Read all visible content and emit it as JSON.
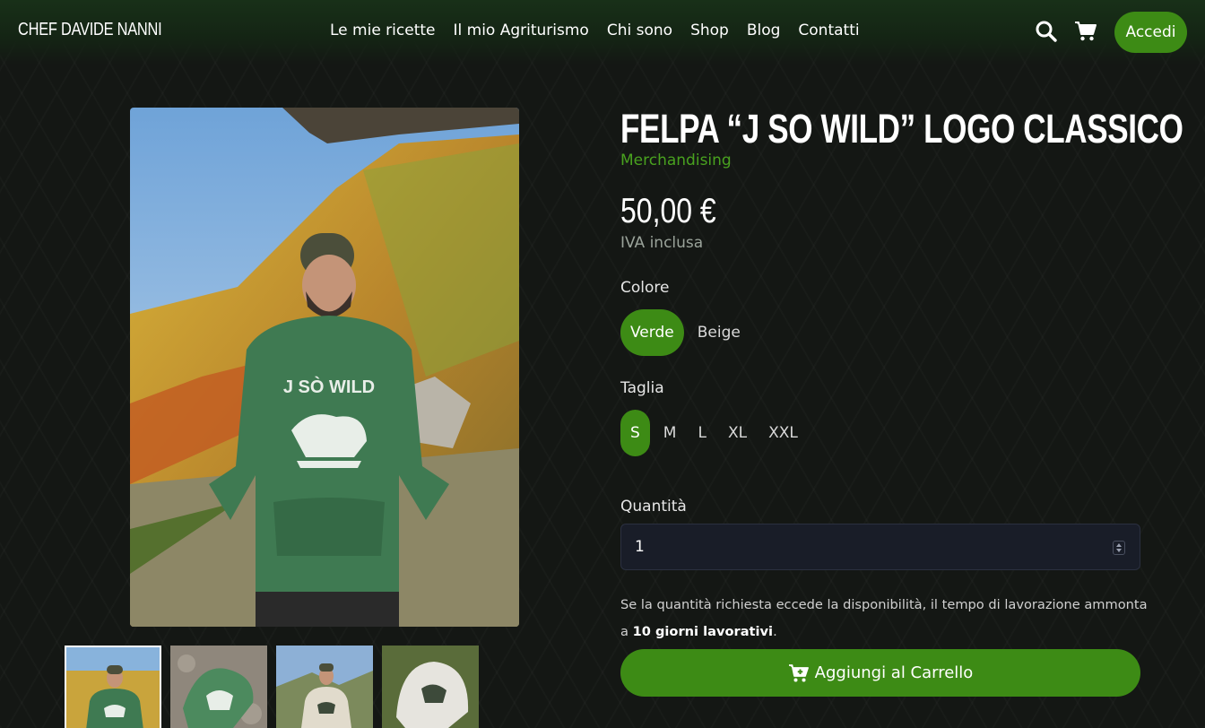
{
  "header": {
    "brand": "CHEF DAVIDE NANNI",
    "nav": [
      "Le mie ricette",
      "Il mio Agriturismo",
      "Chi sono",
      "Shop",
      "Blog",
      "Contatti"
    ],
    "login_label": "Accedi",
    "icons": [
      "search-icon",
      "cart-icon"
    ]
  },
  "product": {
    "title": "FELPA “J SO WILD” LOGO CLASSICO",
    "category": "Merchandising",
    "price": "50,00 €",
    "vat_note": "IVA inclusa",
    "print_text": "J SÒ WILD"
  },
  "options": {
    "color_label": "Colore",
    "colors": [
      "Verde",
      "Beige"
    ],
    "selected_color": "Verde",
    "size_label": "Taglia",
    "sizes": [
      "S",
      "M",
      "L",
      "XL",
      "XXL"
    ],
    "selected_size": "S"
  },
  "quantity": {
    "label": "Quantità",
    "value": "1"
  },
  "notice": {
    "text": "Se la quantità richiesta eccede la disponibilità, il tempo di lavorazione ammonta a",
    "bold": "10 giorni lavorativi",
    "end": "."
  },
  "cart_button": {
    "label": "Aggiungi al Carrello",
    "icon": "cart-plus-icon"
  },
  "colors": {
    "accent": "#3d8b15",
    "category": "#49a21f",
    "background": "#141714",
    "hoodie_green": "#3f7a52"
  }
}
